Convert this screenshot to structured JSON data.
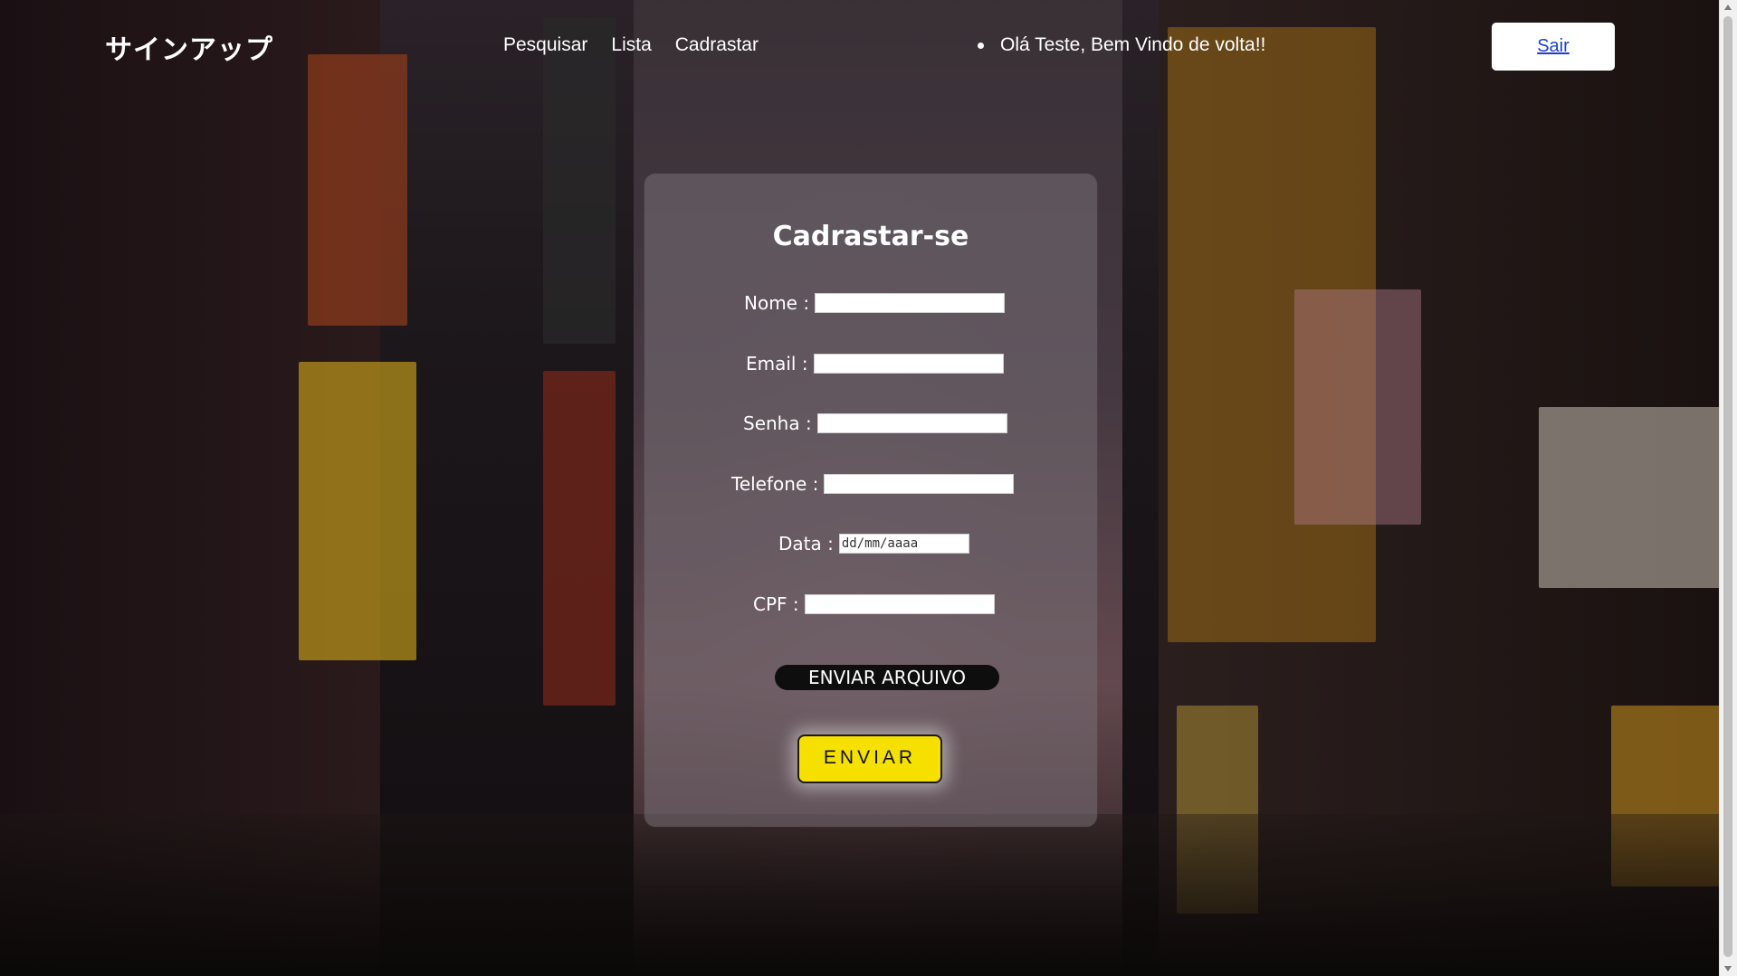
{
  "header": {
    "logo": "サインアップ",
    "nav": [
      "Pesquisar",
      "Lista",
      "Cadrastar"
    ],
    "greeting": "Olá Teste, Bem Vindo de volta!!",
    "logout_label": "Sair"
  },
  "form": {
    "title": "Cadrastar-se",
    "fields": [
      {
        "label": "Nome :",
        "value": ""
      },
      {
        "label": "Email :",
        "value": ""
      },
      {
        "label": "Senha :",
        "value": ""
      },
      {
        "label": "Telefone :",
        "value": ""
      },
      {
        "label": "Data :",
        "value": "dd/mm/aaaa"
      },
      {
        "label": "CPF :",
        "value": ""
      }
    ],
    "file_button": "ENVIAR ARQUIVO",
    "submit_button": "ENVIAR"
  },
  "colors": {
    "submit": "#f5e000",
    "logout_link": "#1a3fd0"
  }
}
